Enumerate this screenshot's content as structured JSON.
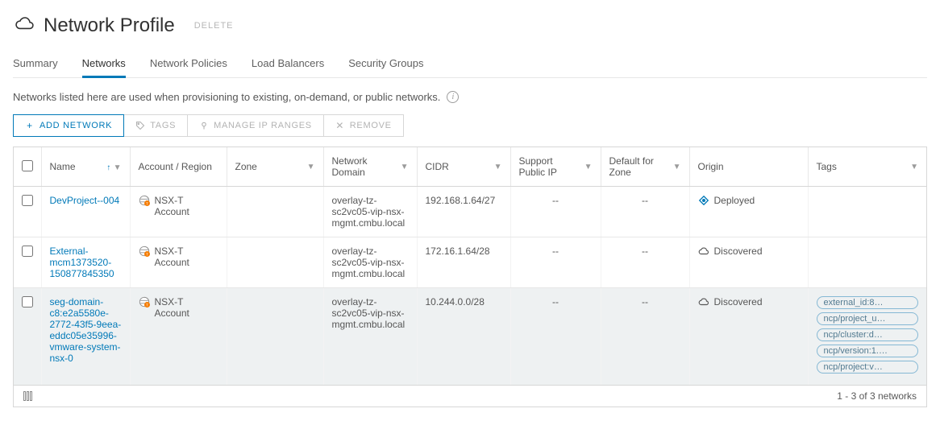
{
  "header": {
    "title": "Network Profile",
    "delete_label": "DELETE"
  },
  "tabs": {
    "items": [
      {
        "label": "Summary"
      },
      {
        "label": "Networks"
      },
      {
        "label": "Network Policies"
      },
      {
        "label": "Load Balancers"
      },
      {
        "label": "Security Groups"
      }
    ],
    "active_index": 1
  },
  "description": "Networks listed here are used when provisioning to existing, on-demand, or public networks.",
  "toolbar": {
    "add_label": "ADD NETWORK",
    "tags_label": "TAGS",
    "manage_ip_label": "MANAGE IP RANGES",
    "remove_label": "REMOVE"
  },
  "columns": {
    "name": "Name",
    "account": "Account / Region",
    "zone": "Zone",
    "network_domain": "Network Domain",
    "cidr": "CIDR",
    "support_public_ip": "Support Public IP",
    "default_for_zone": "Default for Zone",
    "origin": "Origin",
    "tags": "Tags"
  },
  "rows": [
    {
      "name": "DevProject--004",
      "account": "NSX-T Account",
      "zone": "",
      "network_domain": "overlay-tz-sc2vc05-vip-nsx-mgmt.cmbu.local",
      "cidr": "192.168.1.64/27",
      "support_public_ip": "--",
      "default_for_zone": "--",
      "origin": "Deployed",
      "origin_kind": "deployed",
      "tags": []
    },
    {
      "name": "External-mcm1373520-150877845350",
      "account": "NSX-T Account",
      "zone": "",
      "network_domain": "overlay-tz-sc2vc05-vip-nsx-mgmt.cmbu.local",
      "cidr": "172.16.1.64/28",
      "support_public_ip": "--",
      "default_for_zone": "--",
      "origin": "Discovered",
      "origin_kind": "discovered",
      "tags": []
    },
    {
      "name": "seg-domain-c8:e2a5580e-2772-43f5-9eea-eddc05e35996-vmware-system-nsx-0",
      "account": "NSX-T Account",
      "zone": "",
      "network_domain": "overlay-tz-sc2vc05-vip-nsx-mgmt.cmbu.local",
      "cidr": "10.244.0.0/28",
      "support_public_ip": "--",
      "default_for_zone": "--",
      "origin": "Discovered",
      "origin_kind": "discovered",
      "tags": [
        "external_id:8…",
        "ncp/project_u…",
        "ncp/cluster:d…",
        "ncp/version:1.…",
        "ncp/project:v…"
      ]
    }
  ],
  "selected_row_index": 2,
  "footer": {
    "text": "1 - 3 of 3 networks"
  }
}
